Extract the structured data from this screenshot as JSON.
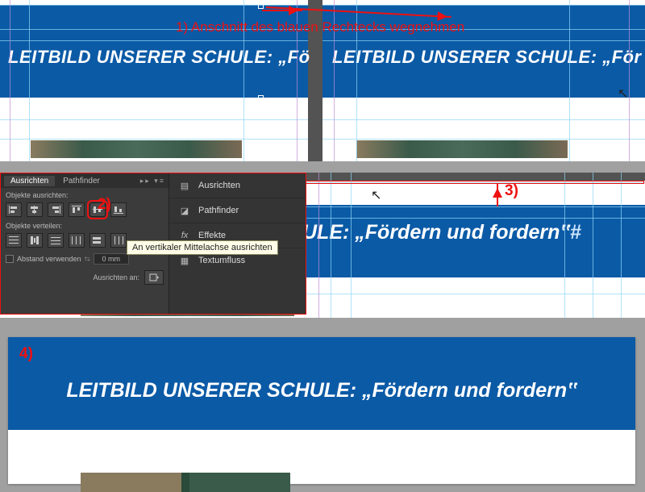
{
  "annotations": {
    "a1": "1) Anschnitt des blauen Rechtecks wegnehmen",
    "a2": "2)",
    "a3": "3)",
    "a4": "4)"
  },
  "headline": {
    "partial_left": "LEITBILD UNSERER SCHULE: „Fö",
    "partial_right": "LEITBILD UNSERER SCHULE: „För",
    "mid_fragment": "ULE: „Fördern und fordern‟",
    "full": "LEITBILD UNSERER SCHULE: „Fördern und fordern‟"
  },
  "panel": {
    "tabs": {
      "align": "Ausrichten",
      "pathfinder": "Pathfinder"
    },
    "labels": {
      "align_objects": "Objekte ausrichten:",
      "distribute_objects": "Objekte verteilen:",
      "use_spacing": "Abstand verwenden",
      "spacing_value": "0 mm",
      "align_to": "Ausrichten an:"
    },
    "tooltip": "An vertikaler Mittelachse ausrichten",
    "menu": {
      "ausrichten": "Ausrichten",
      "pathfinder": "Pathfinder",
      "effekte": "Effekte",
      "textumfluss": "Textumfluss"
    }
  }
}
